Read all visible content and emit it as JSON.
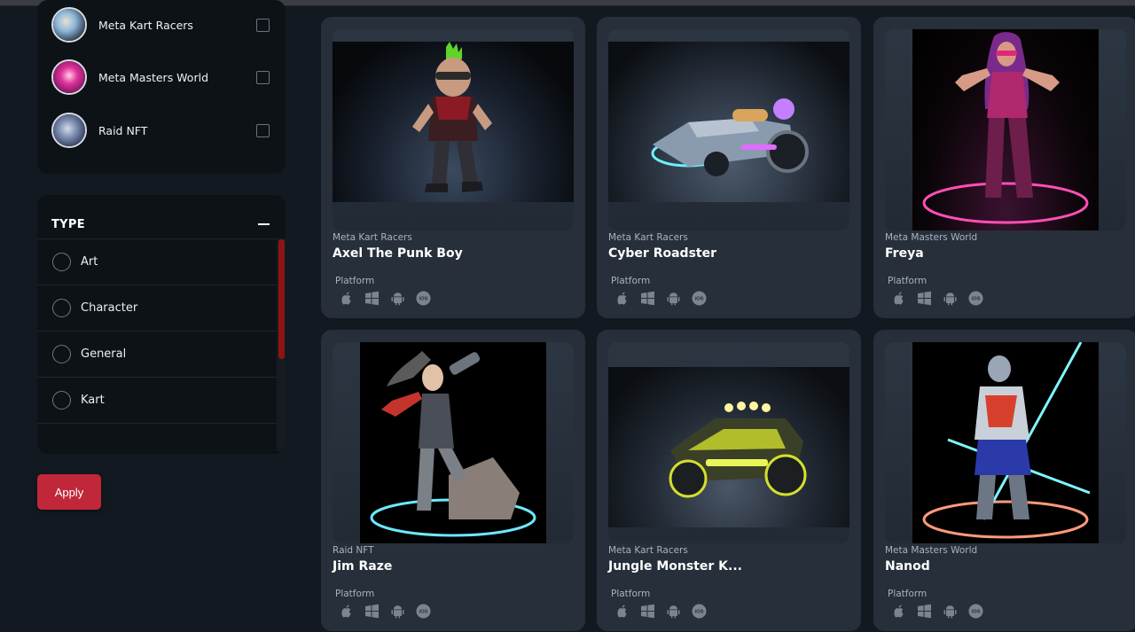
{
  "sidebar": {
    "collections": [
      {
        "label": "Meta Kart Racers",
        "checked": false
      },
      {
        "label": "Meta Masters World",
        "checked": false
      },
      {
        "label": "Raid NFT",
        "checked": false
      }
    ],
    "type_filter": {
      "heading": "TYPE",
      "options": [
        {
          "label": "Art"
        },
        {
          "label": "Character"
        },
        {
          "label": "General"
        },
        {
          "label": "Kart"
        }
      ]
    },
    "apply_label": "Apply"
  },
  "cards": [
    {
      "collection": "Meta Kart Racers",
      "title": "Axel The Punk Boy",
      "platform_label": "Platform",
      "platforms": [
        "apple-icon",
        "windows-icon",
        "android-icon",
        "ios-icon"
      ]
    },
    {
      "collection": "Meta Kart Racers",
      "title": "Cyber Roadster",
      "platform_label": "Platform",
      "platforms": [
        "apple-icon",
        "windows-icon",
        "android-icon",
        "ios-icon"
      ]
    },
    {
      "collection": "Meta Masters World",
      "title": "Freya",
      "platform_label": "Platform",
      "platforms": [
        "apple-icon",
        "windows-icon",
        "android-icon",
        "ios-icon"
      ]
    },
    {
      "collection": "Raid NFT",
      "title": "Jim Raze",
      "platform_label": "Platform",
      "platforms": [
        "apple-icon",
        "windows-icon",
        "android-icon",
        "ios-icon"
      ]
    },
    {
      "collection": "Meta Kart Racers",
      "title": "Jungle Monster K...",
      "platform_label": "Platform",
      "platforms": [
        "apple-icon",
        "windows-icon",
        "android-icon",
        "ios-icon"
      ]
    },
    {
      "collection": "Meta Masters World",
      "title": "Nanod",
      "platform_label": "Platform",
      "platforms": [
        "apple-icon",
        "windows-icon",
        "android-icon",
        "ios-icon"
      ]
    }
  ],
  "ios_badge_text": "iOS",
  "colors": {
    "background": "#121920",
    "panel": "#0d1217",
    "card": "#262f3a",
    "accent": "#c0283a",
    "scrollbar": "#8e1414"
  }
}
